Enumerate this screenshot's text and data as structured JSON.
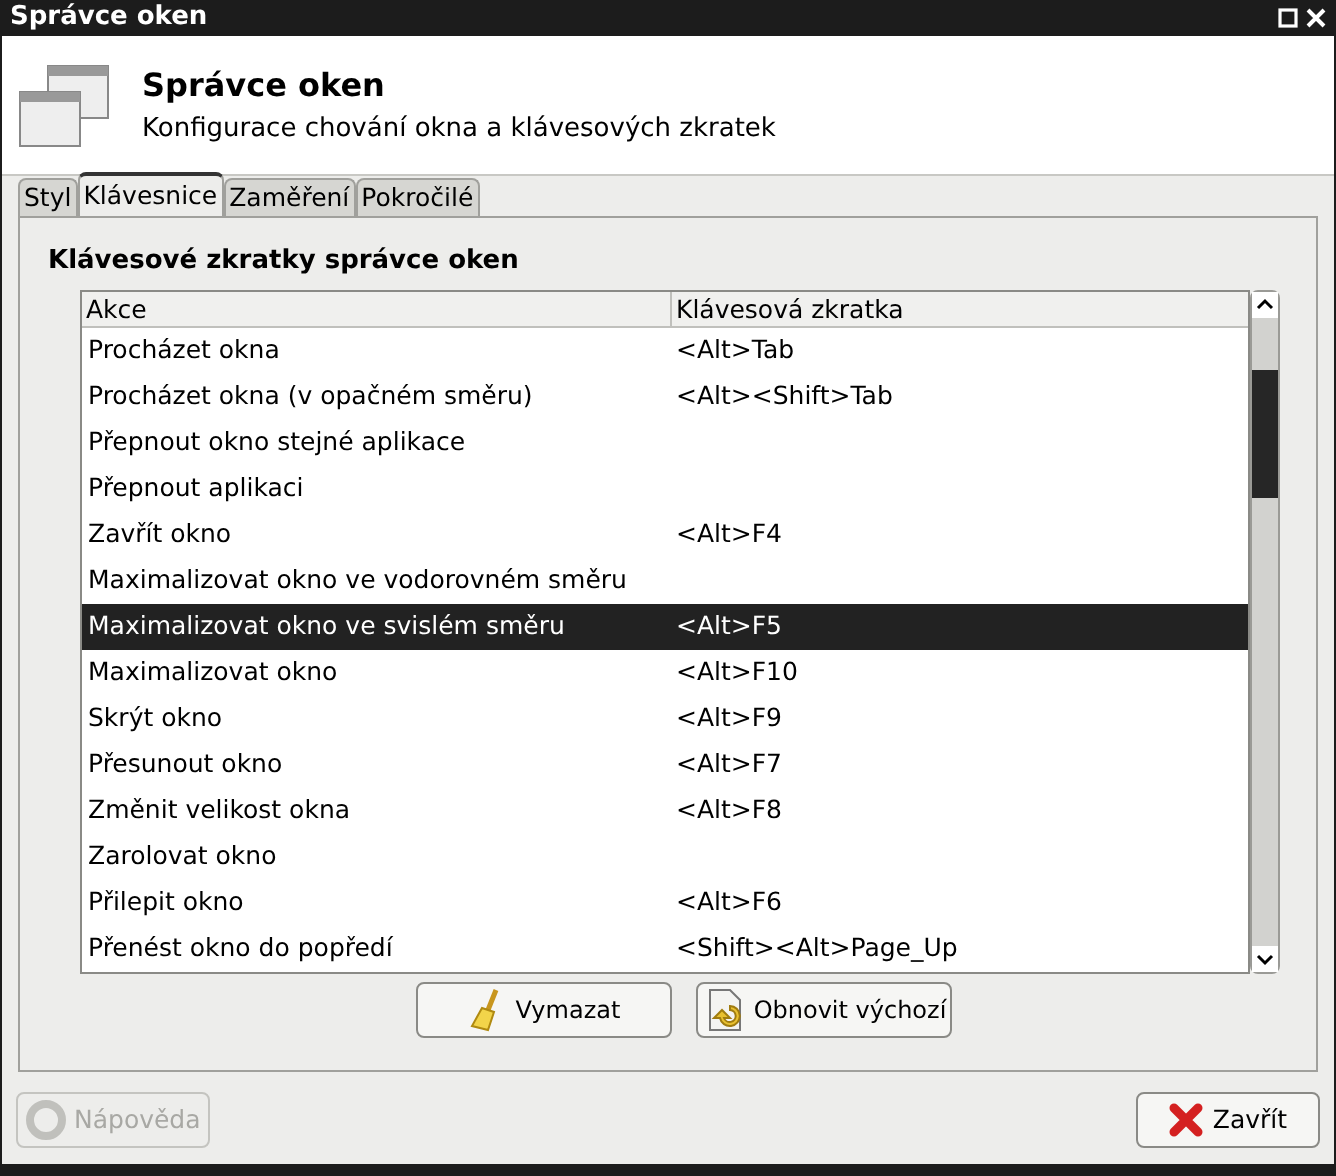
{
  "window": {
    "title": "Správce oken"
  },
  "header": {
    "title": "Správce oken",
    "subtitle": "Konfigurace chování okna a klávesových zkratek"
  },
  "tabs": [
    {
      "label": "Styl",
      "selected": false
    },
    {
      "label": "Klávesnice",
      "selected": true
    },
    {
      "label": "Zaměření",
      "selected": false
    },
    {
      "label": "Pokročilé",
      "selected": false
    }
  ],
  "group_title": "Klávesové zkratky správce oken",
  "table": {
    "columns": [
      "Akce",
      "Klávesová zkratka"
    ],
    "rows": [
      {
        "action": "Procházet okna",
        "shortcut": "<Alt>Tab",
        "selected": false
      },
      {
        "action": "Procházet okna (v opačném směru)",
        "shortcut": "<Alt><Shift>Tab",
        "selected": false
      },
      {
        "action": "Přepnout okno stejné aplikace",
        "selected": false
      },
      {
        "action": "Přepnout aplikaci",
        "selected": false
      },
      {
        "action": "Zavřít okno",
        "shortcut": "<Alt>F4",
        "selected": false
      },
      {
        "action": "Maximalizovat okno ve vodorovném směru",
        "selected": false
      },
      {
        "action": "Maximalizovat okno ve svislém směru",
        "shortcut": "<Alt>F5",
        "selected": true
      },
      {
        "action": "Maximalizovat okno",
        "shortcut": "<Alt>F10",
        "selected": false
      },
      {
        "action": "Skrýt okno",
        "shortcut": "<Alt>F9",
        "selected": false
      },
      {
        "action": "Přesunout okno",
        "shortcut": "<Alt>F7",
        "selected": false
      },
      {
        "action": "Změnit velikost okna",
        "shortcut": "<Alt>F8",
        "selected": false
      },
      {
        "action": "Zarolovat okno",
        "selected": false
      },
      {
        "action": "Přilepit okno",
        "shortcut": "<Alt>F6",
        "selected": false
      },
      {
        "action": "Přenést okno do popředí",
        "shortcut": "<Shift><Alt>Page_Up",
        "selected": false
      }
    ]
  },
  "table_buttons": [
    "Vymazat",
    "Obnovit výchozí"
  ],
  "help_button": {
    "label": "Nápověda",
    "disabled": true
  },
  "close_button": {
    "label": "Zavřít"
  }
}
